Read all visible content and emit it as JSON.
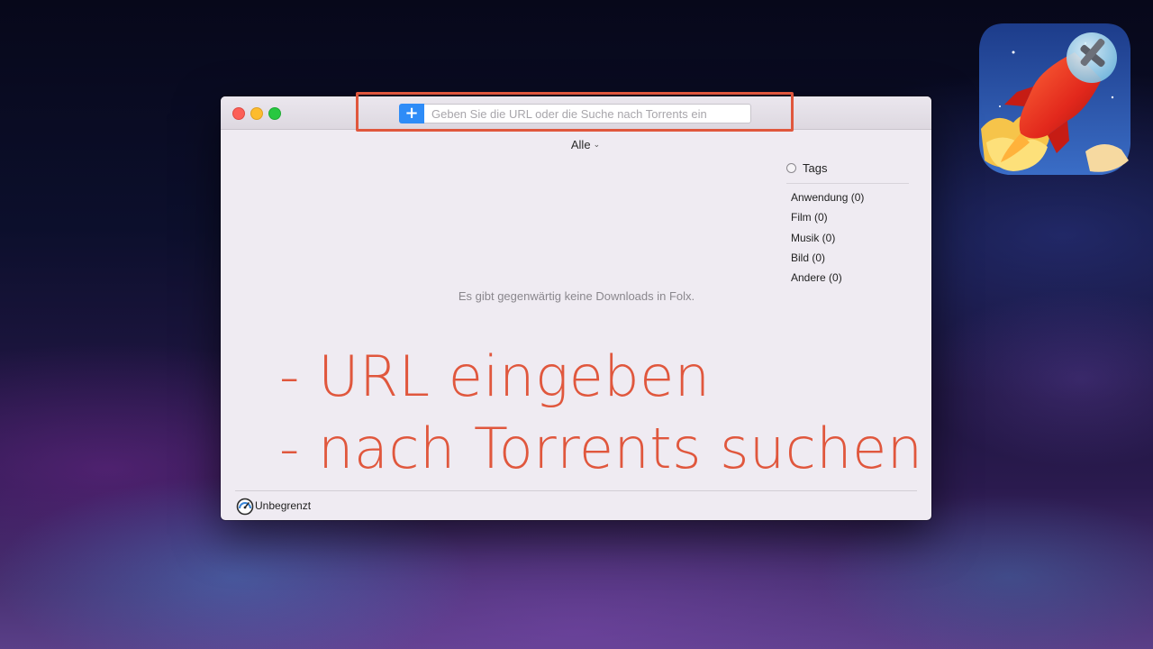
{
  "window": {
    "search_placeholder": "Geben Sie die URL oder die Suche nach Torrents ein",
    "add_button": "+"
  },
  "filter": {
    "label": "Alle"
  },
  "main": {
    "empty_message": "Es gibt gegenwärtig keine Downloads in Folx."
  },
  "tags": {
    "title": "Tags",
    "items": [
      {
        "label": "Anwendung (0)"
      },
      {
        "label": "Film (0)"
      },
      {
        "label": "Musik (0)"
      },
      {
        "label": "Bild (0)"
      },
      {
        "label": "Andere (0)"
      }
    ]
  },
  "overlay": {
    "line1": "- URL eingeben",
    "line2": "- nach Torrents suchen"
  },
  "status": {
    "speed_label": "Unbegrenzt"
  },
  "colors": {
    "accent_orange": "#e0573d",
    "add_button_blue": "#2e8cf7"
  },
  "icons": {
    "app": "rocket-app-icon",
    "speed": "speedometer-icon"
  }
}
